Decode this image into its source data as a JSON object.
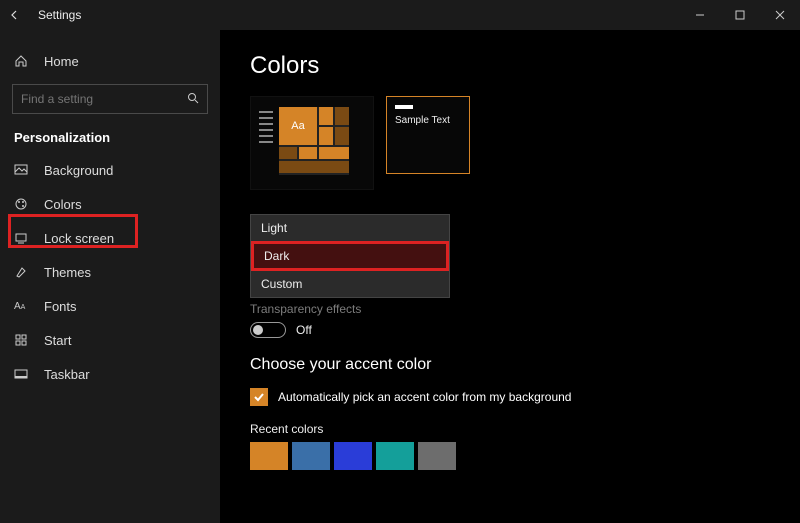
{
  "title": "Settings",
  "page_title": "Colors",
  "search_placeholder": "Find a setting",
  "home_label": "Home",
  "section_label": "Personalization",
  "sidebar_items": {
    "background": "Background",
    "colors": "Colors",
    "lockscreen": "Lock screen",
    "themes": "Themes",
    "fonts": "Fonts",
    "start": "Start",
    "taskbar": "Taskbar"
  },
  "preview": {
    "aa_text": "Aa",
    "sample_text": "Sample Text"
  },
  "dropdown": {
    "light": "Light",
    "dark": "Dark",
    "custom": "Custom"
  },
  "transparency_label": "Transparency effects",
  "toggle_off": "Off",
  "accent_heading": "Choose your accent color",
  "auto_pick_label": "Automatically pick an accent color from my background",
  "recent_label": "Recent colors",
  "swatches": {
    "c1": "#d58427",
    "c2": "#3a6fa8",
    "c3": "#2a3dd8",
    "c4": "#149f9a",
    "c5": "#6d6d6d"
  }
}
